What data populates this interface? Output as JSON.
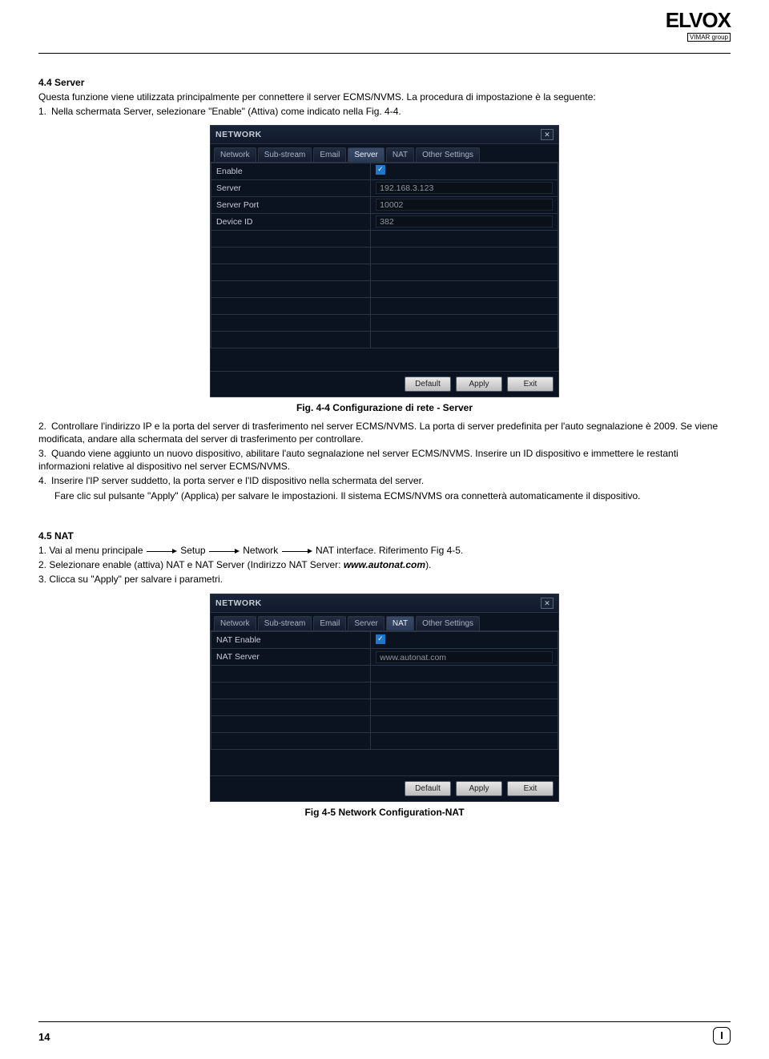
{
  "logo": {
    "main": "ELVOX",
    "sub": "VIMAR group"
  },
  "section_server": {
    "heading": "4.4  Server",
    "intro": "Questa funzione viene utilizzata principalmente per connettere il server ECMS/NVMS. La procedura di impostazione è la seguente:",
    "step1": "Nella schermata Server, selezionare \"Enable\" (Attiva) come indicato nella Fig. 4-4.",
    "caption": "Fig. 4-4 Configurazione di rete - Server",
    "step2": "Controllare l'indirizzo IP e la porta del server di trasferimento nel server ECMS/NVMS. La porta di server predefinita per l'auto segnalazione è 2009. Se viene modificata, andare alla schermata del server di trasferimento per controllare.",
    "step3": "Quando viene aggiunto un nuovo dispositivo, abilitare l'auto segnalazione nel server ECMS/NVMS. Inserire un ID dispositivo e immettere le restanti informazioni relative al dispositivo nel server ECMS/NVMS.",
    "step4a": "Inserire l'IP server suddetto, la porta server e l'ID dispositivo nella schermata del server.",
    "step4b": "Fare clic sul pulsante \"Apply\" (Applica) per salvare le impostazioni.  Il sistema ECMS/NVMS ora connetterà automaticamente il dispositivo."
  },
  "server_window": {
    "title": "NETWORK",
    "tabs": [
      "Network",
      "Sub-stream",
      "Email",
      "Server",
      "NAT",
      "Other Settings"
    ],
    "active_tab": 3,
    "rows": {
      "enable": "Enable",
      "server": "Server",
      "server_port": "Server Port",
      "device_id": "Device ID"
    },
    "values": {
      "server": "192.168.3.123",
      "server_port": "10002",
      "device_id": "382"
    },
    "buttons": {
      "default": "Default",
      "apply": "Apply",
      "exit": "Exit"
    }
  },
  "section_nat": {
    "heading": "4.5 NAT",
    "line1_pre": "1. Vai al menu principale",
    "line1_parts": [
      "Setup",
      "Network",
      "NAT interface. Riferimento Fig 4-5."
    ],
    "line2_pre": "2. Selezionare enable (attiva) NAT e NAT Server (Indirizzo NAT Server: ",
    "line2_bold": "www.autonat.com",
    "line2_post": ").",
    "line3": "3. Clicca su \"Apply\" per salvare i parametri.",
    "caption": "Fig 4-5 Network Configuration-NAT"
  },
  "nat_window": {
    "title": "NETWORK",
    "tabs": [
      "Network",
      "Sub-stream",
      "Email",
      "Server",
      "NAT",
      "Other Settings"
    ],
    "active_tab": 4,
    "rows": {
      "nat_enable": "NAT Enable",
      "nat_server": "NAT Server"
    },
    "values": {
      "nat_server": "www.autonat.com"
    },
    "buttons": {
      "default": "Default",
      "apply": "Apply",
      "exit": "Exit"
    }
  },
  "page": {
    "num": "14",
    "i": "I"
  }
}
